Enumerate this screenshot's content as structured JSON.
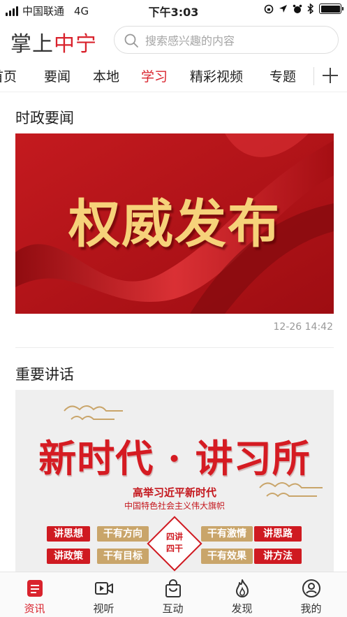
{
  "status_bar": {
    "carrier": "中国联通",
    "network": "4G",
    "time": "下午3:03",
    "battery_level": 1.0,
    "icons": [
      "signal-icon",
      "lock-rotation-icon",
      "location-icon",
      "alarm-icon",
      "bluetooth-icon",
      "battery-icon"
    ]
  },
  "header": {
    "logo_part1": "掌上",
    "logo_part2": "中宁",
    "search_placeholder": "搜索感兴趣的内容"
  },
  "tabs": {
    "items": [
      "首页",
      "要闻",
      "本地",
      "学习",
      "精彩视频",
      "专题"
    ],
    "active": "学习",
    "add_icon": "plus-icon"
  },
  "sections": [
    {
      "title": "时政要闻",
      "banner_text": "权威发布",
      "timestamp": "12-26 14:42"
    },
    {
      "title": "重要讲话",
      "banner_title": "新时代 · 讲习所",
      "banner_subtitle": "高举习近平新时代",
      "banner_subtitle2": "中国特色社会主义伟大旗帜",
      "chips": [
        "讲思想",
        "干有方向",
        "干有激情",
        "讲思路",
        "讲政策",
        "干有目标",
        "干有效果",
        "讲方法"
      ],
      "badge": "四讲\n四干"
    }
  ],
  "bottom_nav": {
    "items": [
      {
        "label": "资讯",
        "icon": "news-icon"
      },
      {
        "label": "视听",
        "icon": "video-icon"
      },
      {
        "label": "互动",
        "icon": "shopping-bag-icon"
      },
      {
        "label": "发现",
        "icon": "flame-icon"
      },
      {
        "label": "我的",
        "icon": "profile-icon"
      }
    ],
    "active": "资讯"
  },
  "colors": {
    "accent": "#d9232d",
    "text": "#222222",
    "muted": "#999999"
  }
}
